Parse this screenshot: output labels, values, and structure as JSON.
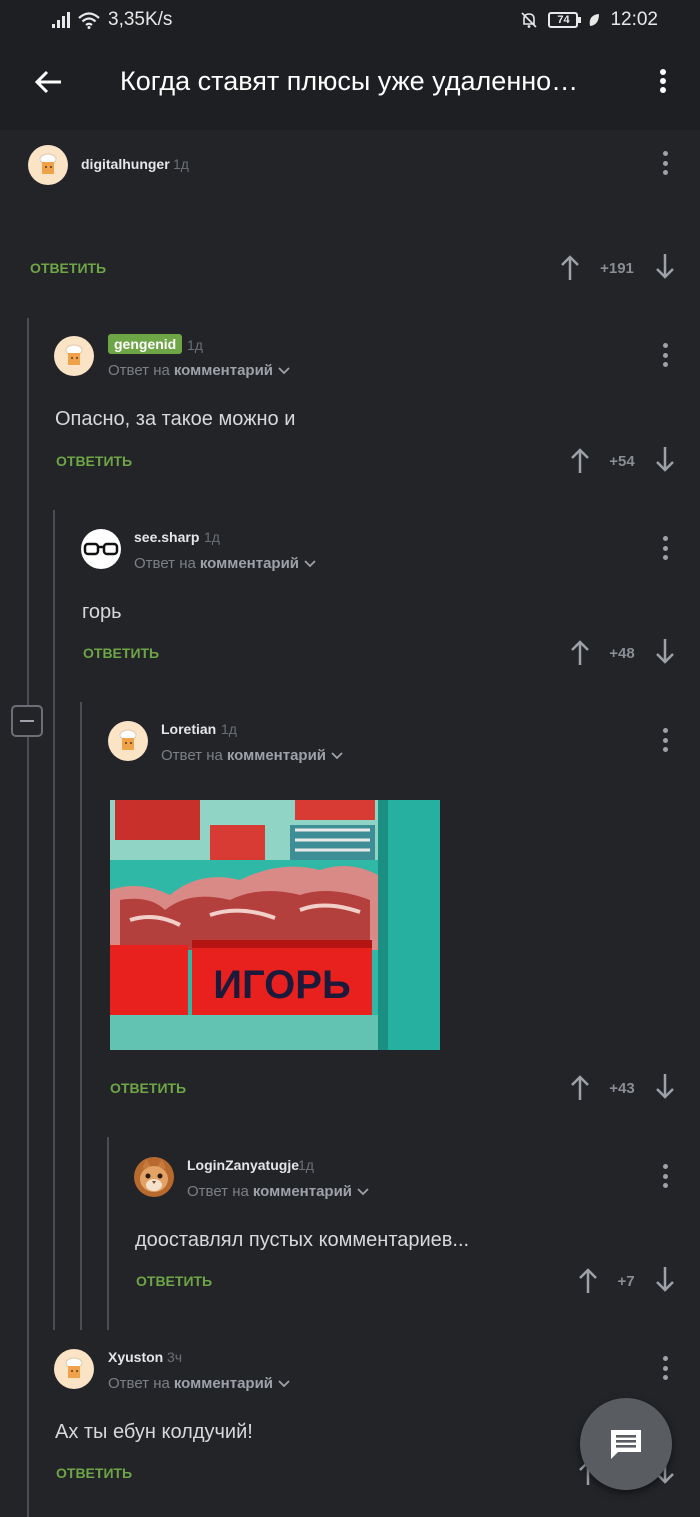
{
  "status_bar": {
    "speed": "3,35K/s",
    "battery": "74",
    "time": "12:02"
  },
  "header": {
    "title": "Когда ставят плюсы уже удаленно…"
  },
  "comments": [
    {
      "user": "digitalhunger",
      "time": "1д",
      "text": "",
      "reply_label": "ОТВЕТИТЬ",
      "score": "+191"
    },
    {
      "user": "gengenid",
      "time": "1д",
      "reply_to_prefix": "Ответ на",
      "reply_to_link": "комментарий",
      "text": "Опасно, за такое можно и",
      "reply_label": "ОТВЕТИТЬ",
      "score": "+54"
    },
    {
      "user": "see.sharp",
      "time": "1д",
      "reply_to_prefix": "Ответ на",
      "reply_to_link": "комментарий",
      "text": "горь",
      "reply_label": "ОТВЕТИТЬ",
      "score": "+48"
    },
    {
      "user": "Loretian",
      "time": "1д",
      "reply_to_prefix": "Ответ на",
      "reply_to_link": "комментарий",
      "image_text": "ИГОРЬ",
      "reply_label": "ОТВЕТИТЬ",
      "score": "+43"
    },
    {
      "user": "LoginZanyatugje",
      "time": "1д",
      "reply_to_prefix": "Ответ на",
      "reply_to_link": "комментарий",
      "text": "дооставлял пустых комментариев...",
      "reply_label": "ОТВЕТИТЬ",
      "score": "+7"
    },
    {
      "user": "Xyuston",
      "time": "3ч",
      "reply_to_prefix": "Ответ на",
      "reply_to_link": "комментарий",
      "text": "Ах ты ебун колдучий!",
      "reply_label": "ОТВЕТИТЬ"
    }
  ],
  "icons": {
    "back": "arrow-left-icon",
    "menu": "more-vertical-icon",
    "upvote": "arrow-up-icon",
    "downvote": "arrow-down-icon",
    "collapse": "minus-square-icon",
    "fab": "comment-icon"
  }
}
